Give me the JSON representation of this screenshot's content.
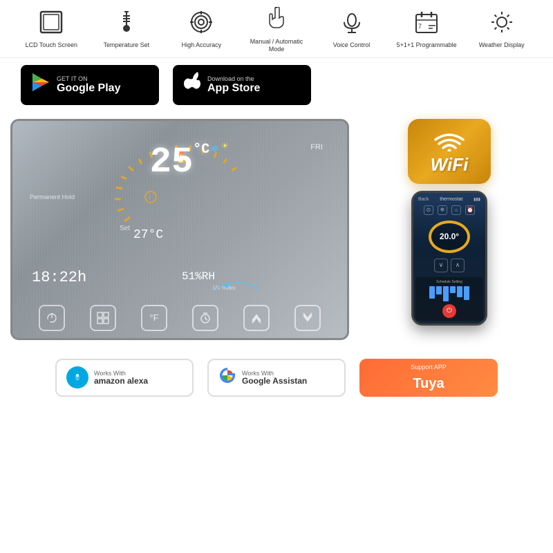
{
  "features": [
    {
      "id": "lcd-touch",
      "icon": "⬜",
      "label": "LCD Touch Screen",
      "svg": "lcd"
    },
    {
      "id": "temp-set",
      "icon": "🌡",
      "label": "Temperature Set",
      "svg": "thermometer"
    },
    {
      "id": "high-accuracy",
      "icon": "🎯",
      "label": "High Accuracy",
      "svg": "target"
    },
    {
      "id": "manual-auto",
      "icon": "👆",
      "label": "Manual / Automatic Mode",
      "svg": "hand"
    },
    {
      "id": "voice-control",
      "icon": "🔊",
      "label": "Voice Control",
      "svg": "speaker"
    },
    {
      "id": "programmable",
      "icon": "📅",
      "label": "5+1+1 Programmable",
      "svg": "calendar"
    },
    {
      "id": "weather-display",
      "icon": "☀",
      "label": "Weather Display",
      "svg": "sun"
    }
  ],
  "stores": {
    "google": {
      "get_it_on": "GET IT ON",
      "name": "Google Play"
    },
    "apple": {
      "download_on": "Download on the",
      "name": "App Store"
    }
  },
  "thermostat": {
    "current_temp": "25",
    "temp_unit": "°C",
    "set_temp": "27°C",
    "set_label": "Set",
    "time": "18:22h",
    "day": "FRI",
    "humidity": "51%RH",
    "uv_label": "UV Index",
    "permanent_hold": "Permanent Hold",
    "buttons": [
      "⏻",
      "⊞",
      "°F",
      "⏰",
      "∧",
      "∨"
    ]
  },
  "wifi": {
    "label": "WiFi"
  },
  "phone": {
    "title": "thermostat",
    "back": "Back",
    "temp": "20.0°",
    "schedule_label": "Schedule Setting"
  },
  "partners": [
    {
      "id": "alexa",
      "works_with": "Works With",
      "name": "amazon alexa"
    },
    {
      "id": "google",
      "works_with": "Works With",
      "name": "Google Assistan"
    },
    {
      "id": "tuya",
      "support": "Support APP",
      "name": "Tuya"
    }
  ]
}
